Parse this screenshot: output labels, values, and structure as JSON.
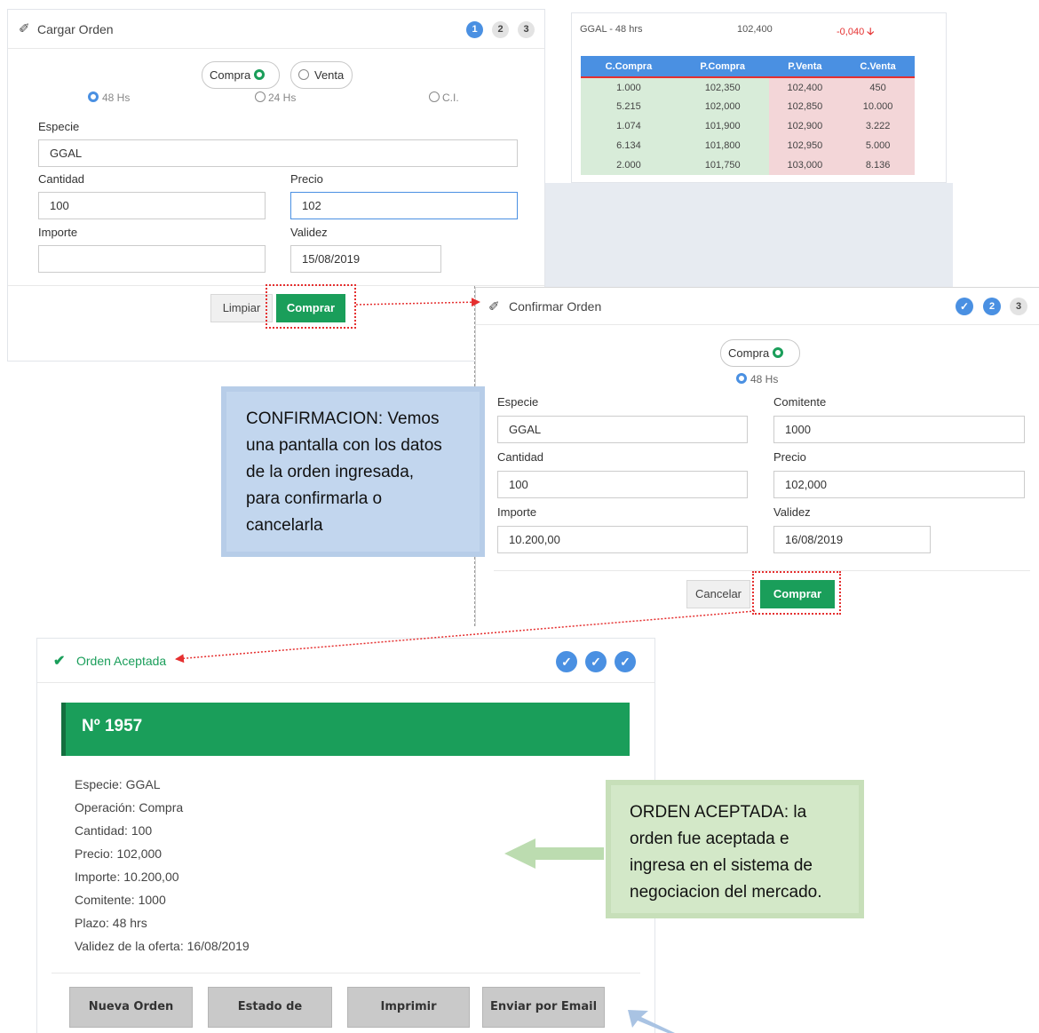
{
  "cargar": {
    "title": "Cargar Orden",
    "steps": [
      "1",
      "2",
      "3"
    ],
    "op_compra": "Compra",
    "op_venta": "Venta",
    "plazo_48": "48 Hs",
    "plazo_24": "24 Hs",
    "plazo_ci": "C.I.",
    "especie_label": "Especie",
    "especie_value": "GGAL",
    "cantidad_label": "Cantidad",
    "cantidad_value": "100",
    "precio_label": "Precio",
    "precio_value": "102",
    "importe_label": "Importe",
    "importe_value": "",
    "validez_label": "Validez",
    "validez_value": "15/08/2019",
    "limpiar": "Limpiar",
    "comprar": "Comprar"
  },
  "quote": {
    "ticker": "GGAL - 48 hrs",
    "last": "102,400",
    "change": "-0,040",
    "change_arrow": "🡣",
    "change_color": "#e53030",
    "headers": [
      "C.Compra",
      "P.Compra",
      "P.Venta",
      "C.Venta"
    ],
    "rows": [
      [
        "1.000",
        "102,350",
        "102,400",
        "450"
      ],
      [
        "5.215",
        "102,000",
        "102,850",
        "10.000"
      ],
      [
        "1.074",
        "101,900",
        "102,900",
        "3.222"
      ],
      [
        "6.134",
        "101,800",
        "102,950",
        "5.000"
      ],
      [
        "2.000",
        "101,750",
        "103,000",
        "8.136"
      ]
    ]
  },
  "confirmar": {
    "title": "Confirmar Orden",
    "steps": [
      "✓",
      "2",
      "3"
    ],
    "op": "Compra",
    "plazo": "48 Hs",
    "especie_label": "Especie",
    "especie_value": "GGAL",
    "comitente_label": "Comitente",
    "comitente_value": "1000",
    "cantidad_label": "Cantidad",
    "cantidad_value": "100",
    "precio_label": "Precio",
    "precio_value": "102,000",
    "importe_label": "Importe",
    "importe_value": "10.200,00",
    "validez_label": "Validez",
    "validez_value": "16/08/2019",
    "cancelar": "Cancelar",
    "comprar": "Comprar"
  },
  "note_confirm": [
    "CONFIRMACION: Vemos",
    "una pantalla con los datos",
    "de la orden ingresada,",
    "para confirmarla o",
    "cancelarla"
  ],
  "aceptada": {
    "title": "Orden Aceptada",
    "check": "✔",
    "steps": [
      "✓",
      "✓",
      "✓"
    ],
    "numero": "Nº 1957",
    "details": [
      "Especie: GGAL",
      "Operación: Compra",
      "Cantidad: 100",
      "Precio: 102,000",
      "Importe: 10.200,00",
      "Comitente: 1000",
      "Plazo: 48 hrs",
      "Validez de la oferta: 16/08/2019"
    ],
    "actions": [
      "Nueva Orden",
      "Estado de Ordenes",
      "Imprimir",
      "Enviar por Email"
    ]
  },
  "note_aceptada": [
    "ORDEN ACEPTADA: la",
    "orden fue aceptada e",
    "ingresa en el sistema de",
    "negociacion del mercado."
  ],
  "colors": {
    "accent_blue": "#4a90e2",
    "green": "#1a9e5a",
    "annotation_red": "#e53030"
  }
}
